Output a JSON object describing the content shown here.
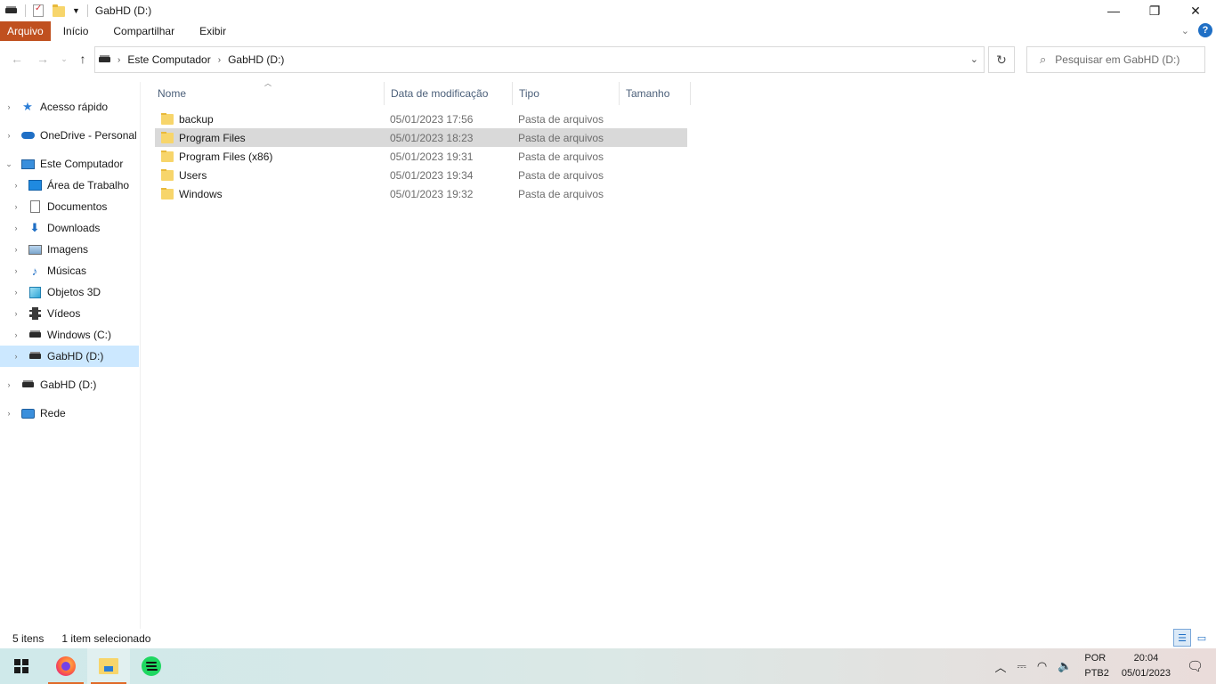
{
  "window": {
    "title": "GabHD (D:)",
    "minimize_glyph": "—",
    "maximize_glyph": "❐",
    "close_glyph": "✕"
  },
  "ribbon": {
    "tabs": [
      "Arquivo",
      "Início",
      "Compartilhar",
      "Exibir"
    ],
    "help_glyph": "?"
  },
  "address": {
    "crumbs": [
      "Este Computador",
      "GabHD (D:)"
    ],
    "search_placeholder": "Pesquisar em GabHD (D:)"
  },
  "sidebar": {
    "items": [
      {
        "label": "Acesso rápido",
        "icon": "star-icon"
      },
      {
        "label": "OneDrive - Personal",
        "icon": "cloud-icon"
      },
      {
        "label": "Este Computador",
        "icon": "computer-icon"
      },
      {
        "label": "Área de Trabalho",
        "icon": "desktop-icon"
      },
      {
        "label": "Documentos",
        "icon": "documents-icon"
      },
      {
        "label": "Downloads",
        "icon": "download-icon"
      },
      {
        "label": "Imagens",
        "icon": "pictures-icon"
      },
      {
        "label": "Músicas",
        "icon": "music-icon"
      },
      {
        "label": "Objetos 3D",
        "icon": "objects-3d-icon"
      },
      {
        "label": "Vídeos",
        "icon": "videos-icon"
      },
      {
        "label": "Windows (C:)",
        "icon": "windows-drive-icon"
      },
      {
        "label": "GabHD (D:)",
        "icon": "drive-icon"
      },
      {
        "label": "GabHD (D:)",
        "icon": "drive-icon"
      },
      {
        "label": "Rede",
        "icon": "network-icon"
      }
    ]
  },
  "columns": [
    "Nome",
    "Data de modificação",
    "Tipo",
    "Tamanho"
  ],
  "files": [
    {
      "name": "backup",
      "date": "05/01/2023 17:56",
      "type": "Pasta de arquivos"
    },
    {
      "name": "Program Files",
      "date": "05/01/2023 18:23",
      "type": "Pasta de arquivos"
    },
    {
      "name": "Program Files (x86)",
      "date": "05/01/2023 19:31",
      "type": "Pasta de arquivos"
    },
    {
      "name": "Users",
      "date": "05/01/2023 19:34",
      "type": "Pasta de arquivos"
    },
    {
      "name": "Windows",
      "date": "05/01/2023 19:32",
      "type": "Pasta de arquivos"
    }
  ],
  "status": {
    "item_count": "5 itens",
    "selection": "1 item selecionado"
  },
  "taskbar": {
    "lang_top": "POR",
    "lang_bottom": "PTB2",
    "time": "20:04",
    "date": "05/01/2023"
  },
  "colors": {
    "file_tab": "#c0501f",
    "selection_sidebar": "#cce8ff",
    "selection_row": "#d9d9d9",
    "folder": "#f7d56b"
  }
}
